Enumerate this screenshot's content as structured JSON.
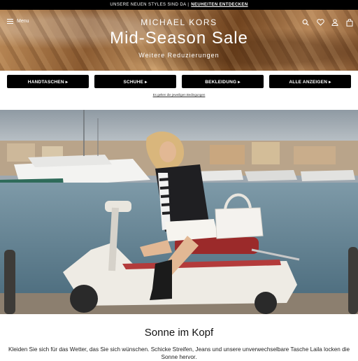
{
  "announcement": {
    "text": "UNSERE NEUEN STYLES SIND DA |",
    "link_label": "NEUHEITEN ENTDECKEN"
  },
  "header": {
    "menu_label": "Menu",
    "brand": "MICHAEL KORS",
    "headline": "Mid-Season Sale",
    "subheadline": "Weitere Reduzierungen",
    "icons": [
      "search-icon",
      "heart-icon",
      "account-icon",
      "bag-icon"
    ]
  },
  "categories": [
    {
      "label": "HANDTASCHEN ▸"
    },
    {
      "label": "SCHUHE ▸"
    },
    {
      "label": "BEKLEIDUNG ▸"
    },
    {
      "label": "ALLE ANZEIGEN ▸"
    }
  ],
  "conditions_link": "Es gelten die jeweiligen Bedingungen",
  "feature": {
    "title": "Sonne im Kopf",
    "text": "Kleiden Sie sich für das Wetter, das Sie sich wünschen. Schicke Streifen, Jeans und unsere unverwechselbare Tasche Laila locken die Sonne hervor."
  }
}
